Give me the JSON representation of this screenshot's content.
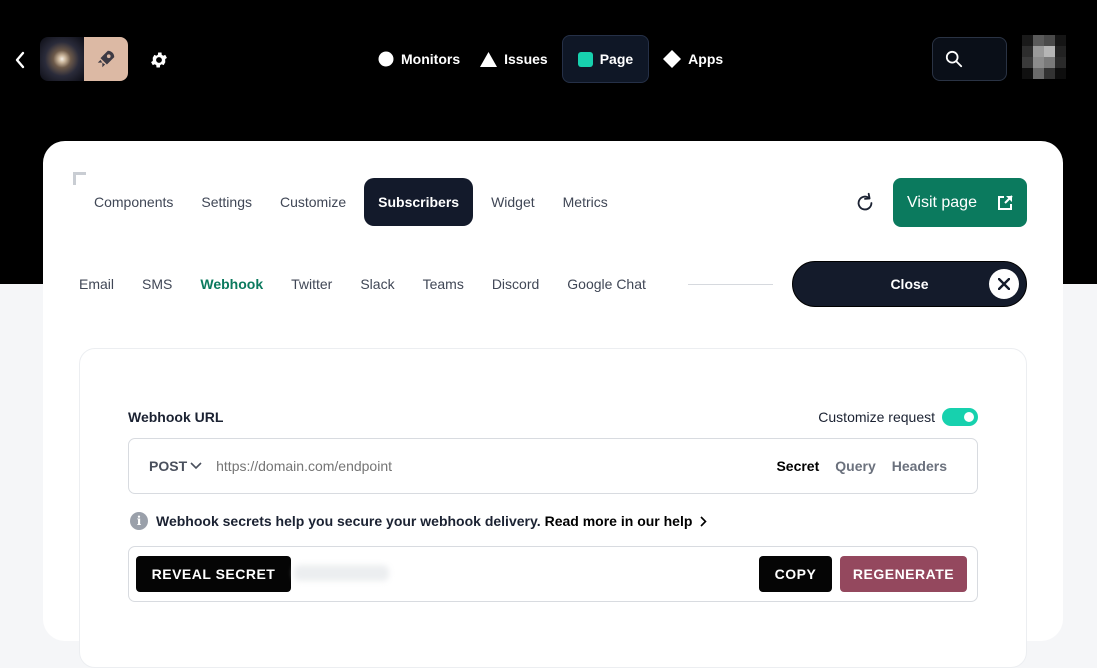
{
  "colors": {
    "accent_green": "#0b7a5e",
    "toggle_on": "#17d1ae",
    "regenerate": "#94485e",
    "dark": "#131a2b"
  },
  "topbar": {
    "back_icon": "chevron-left-icon",
    "settings_icon": "gear-icon",
    "nav": [
      {
        "label": "Monitors",
        "icon": "circle-icon"
      },
      {
        "label": "Issues",
        "icon": "triangle-icon"
      },
      {
        "label": "Page",
        "icon": "square-icon",
        "active": true
      },
      {
        "label": "Apps",
        "icon": "diamond-icon"
      }
    ],
    "search_icon": "search-icon"
  },
  "page_tabs": {
    "items": [
      "Components",
      "Settings",
      "Customize",
      "Subscribers",
      "Widget",
      "Metrics"
    ],
    "active": "Subscribers"
  },
  "actions": {
    "visit_label": "Visit page",
    "close_label": "Close"
  },
  "subscriber_tabs": {
    "items": [
      "Email",
      "SMS",
      "Webhook",
      "Twitter",
      "Slack",
      "Teams",
      "Discord",
      "Google Chat"
    ],
    "active": "Webhook"
  },
  "webhook": {
    "url_label": "Webhook URL",
    "customize_label": "Customize request",
    "customize_enabled": true,
    "method": "POST",
    "url_placeholder": "https://domain.com/endpoint",
    "url_value": "",
    "url_tabs": [
      "Secret",
      "Query",
      "Headers"
    ],
    "url_tab_active": "Secret",
    "info_text": "Webhook secrets help you secure your webhook delivery.",
    "help_link": "Read more in our help",
    "reveal_label": "REVEAL SECRET",
    "copy_label": "COPY",
    "regenerate_label": "REGENERATE"
  }
}
